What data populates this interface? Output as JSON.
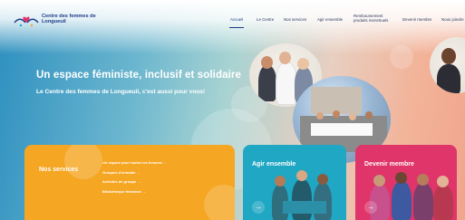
{
  "header": {
    "logo_text": "Centre des femmes de Longueuil",
    "nav": [
      {
        "label": "Accueil",
        "active": true
      },
      {
        "label": "Le Centre"
      },
      {
        "label": "Nos services"
      },
      {
        "label": "Agir ensemble"
      },
      {
        "label": "Remboursement produits menstruels"
      },
      {
        "label": "Devenir membre"
      },
      {
        "label": "Nous joindre"
      }
    ]
  },
  "hero": {
    "title": "Un espace féministe, inclusif et solidaire",
    "subtitle": "Le Centre des femmes de Longueuil, c'est aussi pour vous!"
  },
  "cards": {
    "services": {
      "title": "Nos services",
      "links": [
        "Un espace pour toutes les femmes →",
        "Groupes d'entraide →",
        "Activités de groupe →",
        "Bibliothèque féministe →"
      ]
    },
    "agir": {
      "title": "Agir ensemble",
      "arrow": "→"
    },
    "membre": {
      "title": "Devenir membre",
      "arrow": "→"
    }
  },
  "colors": {
    "brand_blue": "#1d3b8a",
    "services": "#f5a623",
    "agir": "#1fa7c3",
    "membre": "#e0356a"
  }
}
